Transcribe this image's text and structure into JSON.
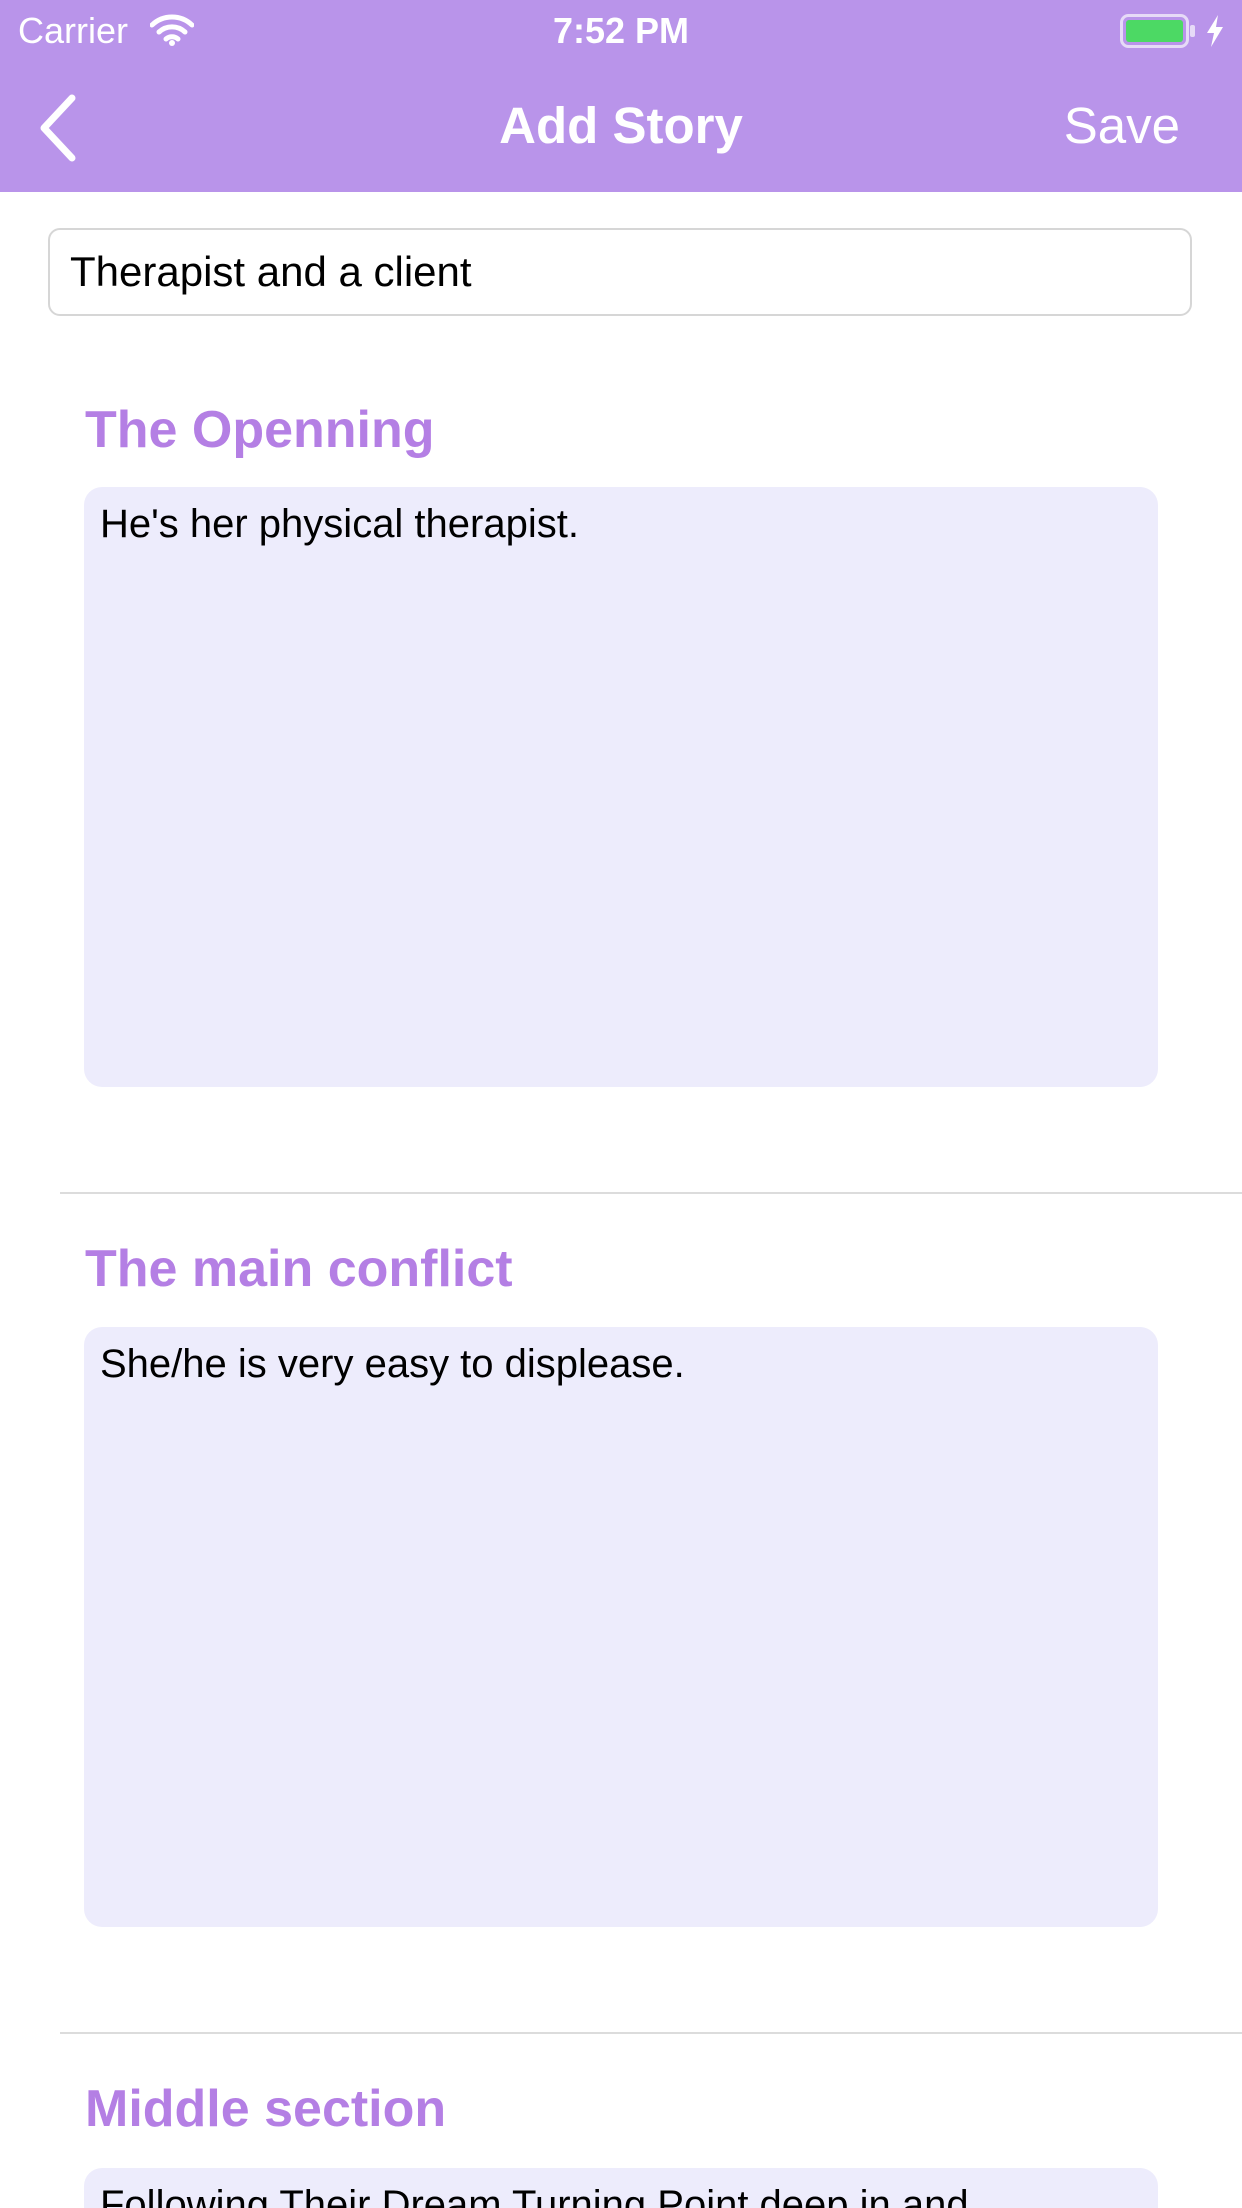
{
  "status_bar": {
    "carrier": "Carrier",
    "time": "7:52 PM",
    "icons": [
      "wifi-icon",
      "battery-icon",
      "charging-bolt-icon"
    ]
  },
  "nav": {
    "back_icon": "chevron-left-icon",
    "title": "Add Story",
    "save_label": "Save"
  },
  "story_title": {
    "value": "Therapist and a client"
  },
  "sections": [
    {
      "heading": "The Openning",
      "text": "He's her physical therapist."
    },
    {
      "heading": "The main conflict",
      "text": "She/he is very easy to displease."
    },
    {
      "heading": "Middle section",
      "text": "Following Their Dream Turning Point deep in and"
    }
  ],
  "colors": {
    "header_background": "#b994ea",
    "heading_accent": "#b47fe4",
    "text_area_background": "#edecfc",
    "battery_fill": "#4cd964"
  }
}
